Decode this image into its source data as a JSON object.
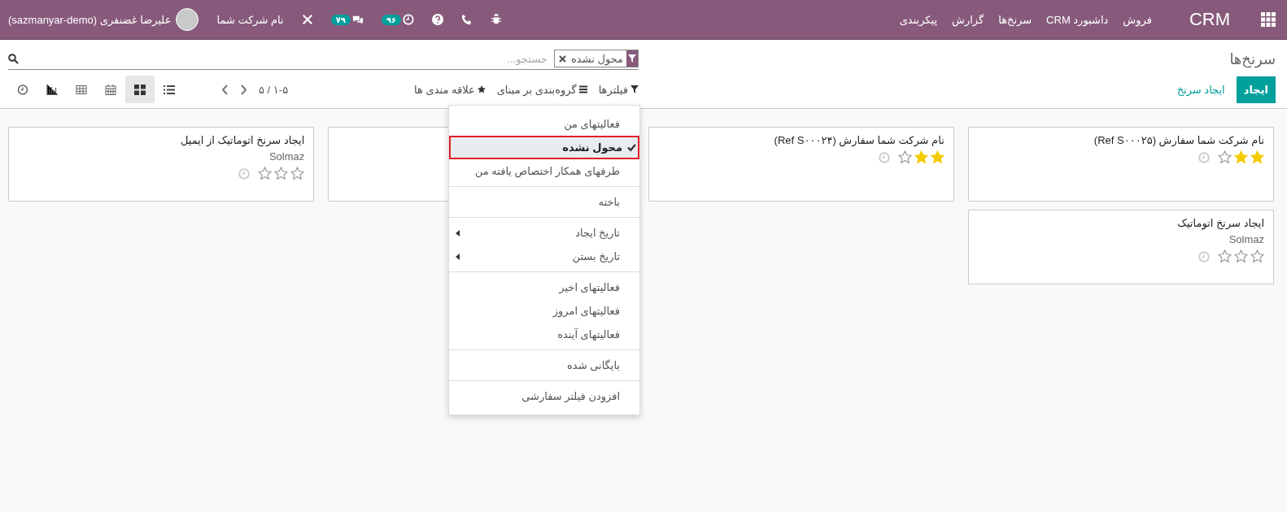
{
  "navbar": {
    "app_name": "CRM",
    "menu": [
      "فروش",
      "داشبورد CRM",
      "سرنخ‌ها",
      "گزارش",
      "پیکربندی"
    ],
    "systray": {
      "activities_badge": "۹۶",
      "messages_badge": "۷۹",
      "company": "نام شرکت شما",
      "user": "علیرضا غضنفری (sazmanyar-demo)"
    }
  },
  "control_panel": {
    "title": "سرنخ‌ها",
    "search": {
      "facet": "محول نشده",
      "placeholder": "جستجو..."
    },
    "buttons": [
      {
        "label": "ایجاد",
        "kind": "primary"
      },
      {
        "label": "ایجاد سرنخ",
        "kind": "link"
      }
    ],
    "search_options": [
      {
        "label": "فیلترها",
        "kind": "filter"
      },
      {
        "label": "گروه‌بندی بر مبنای",
        "kind": "group"
      },
      {
        "label": "علاقه مندی ها",
        "kind": "favorite"
      }
    ],
    "pager": "۱-۵ / ۵",
    "views": [
      {
        "kind": "list",
        "selected": false
      },
      {
        "kind": "kanban",
        "selected": true
      },
      {
        "kind": "calendar",
        "selected": false
      },
      {
        "kind": "pivot",
        "selected": false
      },
      {
        "kind": "graph",
        "selected": false
      },
      {
        "kind": "activity",
        "selected": false
      }
    ]
  },
  "filter_menu": {
    "groups": [
      {
        "items": [
          {
            "label": "فعالیتهای من",
            "kind": "option",
            "checked": false
          },
          {
            "label": "محول نشده",
            "kind": "option",
            "checked": true
          },
          {
            "label": "طرفهای همکار اختصاص یافته من",
            "kind": "option",
            "checked": false
          }
        ]
      },
      {
        "items": [
          {
            "label": "باخته",
            "kind": "option",
            "checked": false
          }
        ]
      },
      {
        "items": [
          {
            "label": "تاریخ ایجاد",
            "kind": "submenu",
            "checked": false
          },
          {
            "label": "تاریخ بستن",
            "kind": "submenu",
            "checked": false
          }
        ]
      },
      {
        "items": [
          {
            "label": "فعالیتهای اخیر",
            "kind": "option",
            "checked": false
          },
          {
            "label": "فعالیتهای امروز",
            "kind": "option",
            "checked": false
          },
          {
            "label": "فعالیتهای آینده",
            "kind": "option",
            "checked": false
          }
        ]
      },
      {
        "items": [
          {
            "label": "بایگانی شده",
            "kind": "option",
            "checked": false
          }
        ]
      },
      {
        "items": [
          {
            "label": "افزودن فیلتر سفارشی",
            "kind": "option",
            "checked": false
          }
        ]
      }
    ]
  },
  "kanban": {
    "columns": [
      {
        "cards": [
          {
            "covered": false,
            "title": "نام شرکت شما سفارش (Ref S۰۰۰۲۵)",
            "stars": 2
          },
          {
            "covered": false,
            "title": "ایجاد سرنخ اتوماتیک",
            "salesperson": "Solmaz",
            "stars": 0
          }
        ]
      },
      {
        "cards": [
          {
            "covered": false,
            "title": "نام شرکت شما سفارش (Ref S۰۰۰۲۴)",
            "stars": 2
          }
        ]
      },
      {
        "cards": [
          {
            "covered": true
          }
        ]
      },
      {
        "cards": [
          {
            "covered": false,
            "title": "ایجاد سرنخ اتوماتیک از ایمیل",
            "salesperson": "Solmaz",
            "stars": 0
          }
        ]
      }
    ]
  }
}
